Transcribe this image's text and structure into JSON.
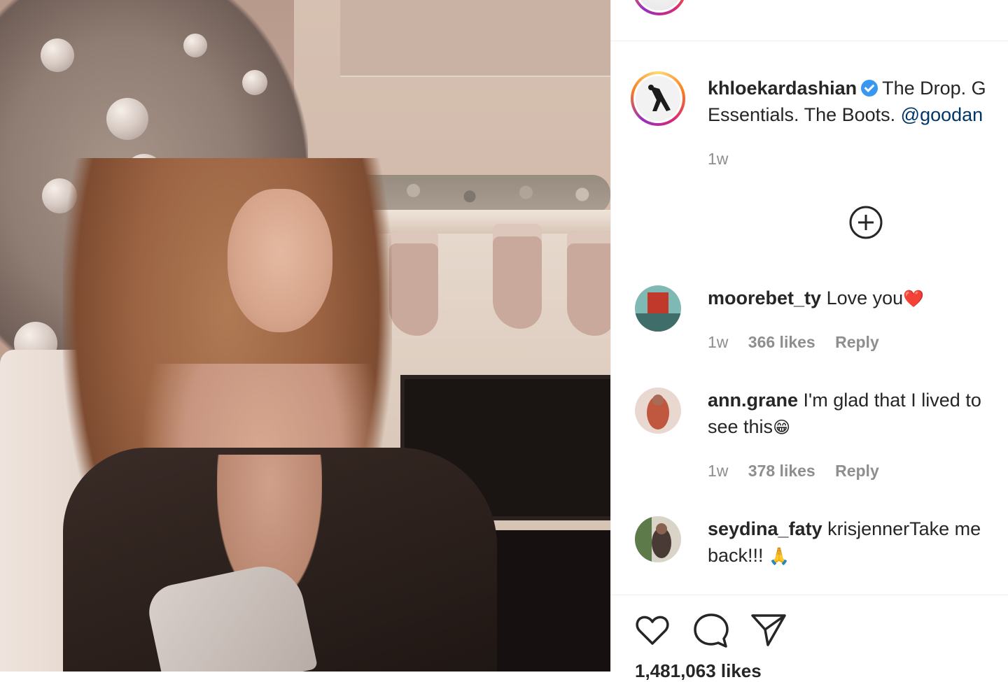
{
  "post": {
    "author": "khloekardashian",
    "caption_line1": "The Drop. G",
    "caption_line2_text": "Essentials. The Boots.",
    "caption_mention": "@goodan",
    "time": "1w"
  },
  "comments": [
    {
      "username": "moorebet_ty",
      "text": "Love you",
      "emoji": "❤️",
      "time": "1w",
      "likes": "366 likes",
      "reply": "Reply"
    },
    {
      "username": "ann.grane",
      "text_line1": "I'm glad that I lived to",
      "text_line2": "see this",
      "emoji": "😁",
      "time": "1w",
      "likes": "378 likes",
      "reply": "Reply"
    },
    {
      "username": "seydina_faty",
      "text_line1": "krisjennerTake me",
      "text_line2": "back!!!",
      "emoji": "🙏"
    }
  ],
  "actions": {
    "like_icon": "heart-icon",
    "comment_icon": "comment-icon",
    "share_icon": "paper-plane-icon",
    "add_icon": "plus-circle-icon"
  },
  "likes_count": "1,481,063 likes",
  "colors": {
    "link": "#00376b",
    "verified": "#3897f0",
    "muted": "#8e8e8e"
  }
}
